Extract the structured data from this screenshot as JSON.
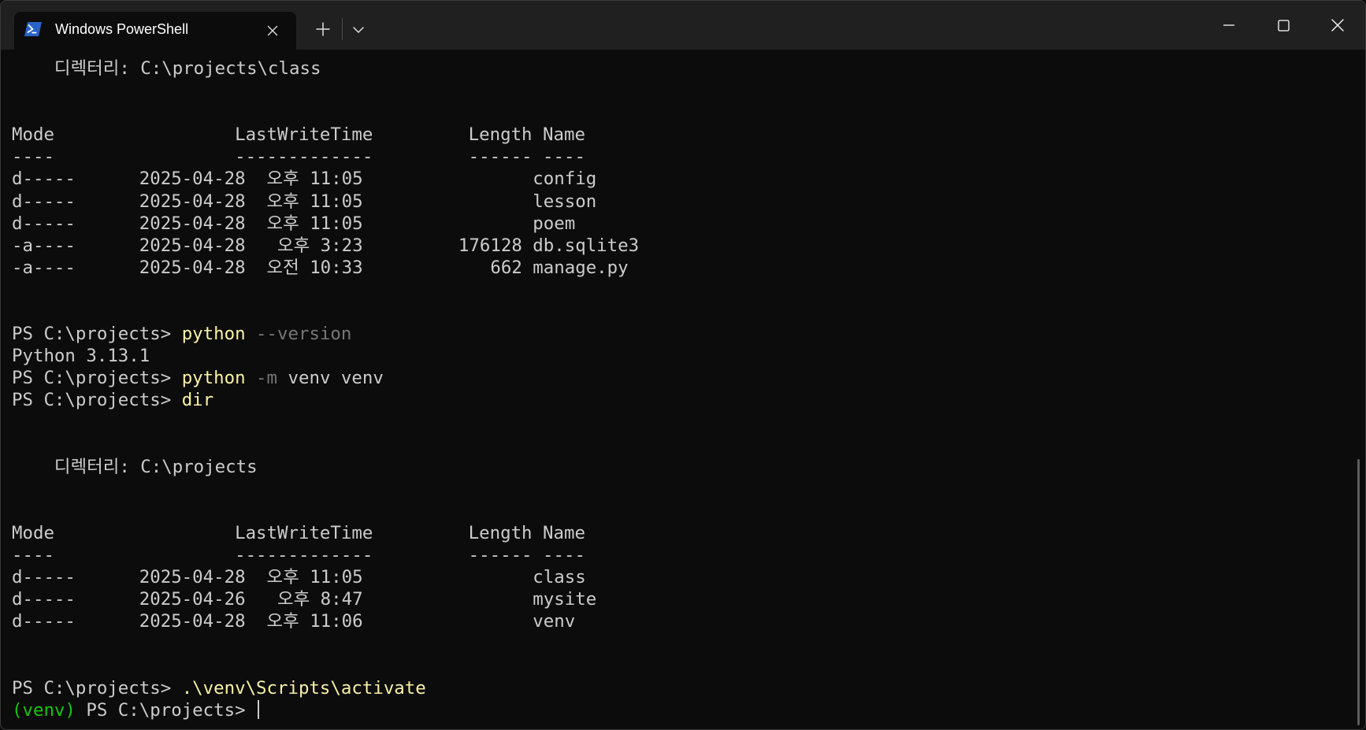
{
  "window": {
    "tab_title": "Windows PowerShell",
    "new_tab_glyph": "+",
    "accent_color": "#2a62c9"
  },
  "terminal": {
    "colors": {
      "foreground": "#cccccc",
      "command": "#f9f1a5",
      "parameter": "#767676",
      "venv_prefix": "#16c60c",
      "background": "#0c0c0c"
    },
    "listing1": {
      "directory_label": "    디렉터리: C:\\projects\\class",
      "header": "Mode                 LastWriteTime         Length Name",
      "separator": "----                 -------------         ------ ----",
      "rows": [
        "d-----      2025-04-28  오후 11:05                config",
        "d-----      2025-04-28  오후 11:05                lesson",
        "d-----      2025-04-28  오후 11:05                poem",
        "-a----      2025-04-28   오후 3:23         176128 db.sqlite3",
        "-a----      2025-04-28  오전 10:33            662 manage.py"
      ]
    },
    "commands": {
      "prompt": "PS C:\\projects> ",
      "version_cmd": "python",
      "version_arg": " --version",
      "version_output": "Python 3.13.1",
      "venv_cmd": "python",
      "venv_flag": " -m",
      "venv_args": " venv venv",
      "dir_cmd": "dir"
    },
    "listing2": {
      "directory_label": "    디렉터리: C:\\projects",
      "header": "Mode                 LastWriteTime         Length Name",
      "separator": "----                 -------------         ------ ----",
      "rows": [
        "d-----      2025-04-28  오후 11:05                class",
        "d-----      2025-04-26   오후 8:47                mysite",
        "d-----      2025-04-28  오후 11:06                venv"
      ]
    },
    "activate": {
      "prompt": "PS C:\\projects> ",
      "cmd": ".\\venv\\Scripts\\activate",
      "venv_prefix": "(venv)",
      "final_prompt": " PS C:\\projects> "
    }
  }
}
